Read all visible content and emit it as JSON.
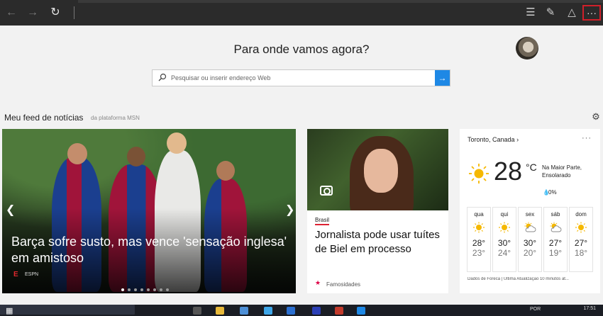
{
  "browser": {
    "nav": {
      "back_icon": "arrow-left-icon",
      "forward_icon": "arrow-right-icon",
      "refresh_icon": "refresh-icon"
    },
    "tools": [
      "hub-icon",
      "web-note-icon",
      "share-icon",
      "more-icon"
    ],
    "more_label": "···"
  },
  "newtab": {
    "headline": "Para onde vamos agora?",
    "search_placeholder": "Pesquisar ou inserir endereço Web"
  },
  "feed": {
    "title": "Meu feed de notícias",
    "subtitle": "da plataforma MSN"
  },
  "hero": {
    "caption": "Barça sofre susto, mas vence 'sensação inglesa' em amistoso",
    "source": "ESPN",
    "source_logo": "E",
    "dot_count": 8,
    "active_dot": 0
  },
  "news_card": {
    "category": "Brasil",
    "title": "Jornalista pode usar tuítes de Biel em processo",
    "source": "Famosidades"
  },
  "weather": {
    "location": "Toronto, Canada",
    "location_chevron": "›",
    "temp": "28",
    "unit": "°C",
    "condition": "Na Maior Parte, Ensolarado",
    "precip": "0%",
    "forecast": [
      {
        "day": "qua",
        "hi": "28°",
        "lo": "23°",
        "icon": "sun-icon"
      },
      {
        "day": "qui",
        "hi": "30°",
        "lo": "24°",
        "icon": "sun-icon"
      },
      {
        "day": "sex",
        "hi": "30°",
        "lo": "20°",
        "icon": "partly-cloudy-icon"
      },
      {
        "day": "sáb",
        "hi": "27°",
        "lo": "19°",
        "icon": "partly-cloudy-icon"
      },
      {
        "day": "dom",
        "hi": "27°",
        "lo": "18°",
        "icon": "sun-icon"
      }
    ],
    "footer": "Dados de Foreca | Última Atualização 10 minutos at..."
  },
  "taskbar": {
    "lang": "POR",
    "time": "17:51"
  },
  "colors": {
    "accent": "#1e88e5",
    "highlight": "#d0202a",
    "sun": "#f5b800"
  }
}
